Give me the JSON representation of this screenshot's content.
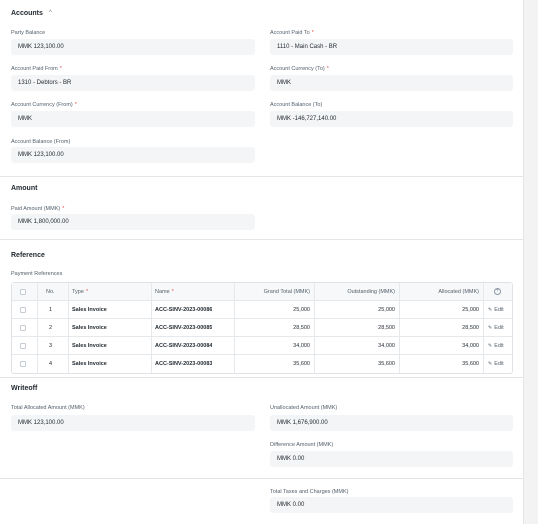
{
  "accounts": {
    "title": "Accounts",
    "party_balance": {
      "label": "Party Balance",
      "value": "MMK 123,100.00"
    },
    "account_paid_to": {
      "label": "Account Paid To",
      "value": "1110 - Main Cash - BR"
    },
    "account_paid_from": {
      "label": "Account Paid From",
      "value": "1310 - Debtors - BR"
    },
    "account_currency_to": {
      "label": "Account Currency (To)",
      "value": "MMK"
    },
    "account_currency_from": {
      "label": "Account Currency (From)",
      "value": "MMK"
    },
    "account_balance_to": {
      "label": "Account Balance (To)",
      "value": "MMK -146,727,140.00"
    },
    "account_balance_from": {
      "label": "Account Balance (From)",
      "value": "MMK 123,100.00"
    }
  },
  "amount": {
    "title": "Amount",
    "paid_amount": {
      "label": "Paid Amount (MMK)",
      "value": "MMK 1,800,000.00"
    }
  },
  "reference": {
    "title": "Reference",
    "table_label": "Payment References",
    "columns": [
      "No.",
      "Type",
      "Name",
      "Grand Total (MMK)",
      "Outstanding (MMK)",
      "Allocated (MMK)"
    ],
    "edit_label": "Edit",
    "rows": [
      {
        "no": "1",
        "type": "Sales Invoice",
        "name": "ACC-SINV-2023-00086",
        "grand_total": "25,000",
        "outstanding": "25,000",
        "allocated": "25,000"
      },
      {
        "no": "2",
        "type": "Sales Invoice",
        "name": "ACC-SINV-2023-00085",
        "grand_total": "28,500",
        "outstanding": "28,500",
        "allocated": "28,500"
      },
      {
        "no": "3",
        "type": "Sales Invoice",
        "name": "ACC-SINV-2023-00084",
        "grand_total": "34,000",
        "outstanding": "34,000",
        "allocated": "34,000"
      },
      {
        "no": "4",
        "type": "Sales Invoice",
        "name": "ACC-SINV-2023-00083",
        "grand_total": "35,600",
        "outstanding": "35,600",
        "allocated": "35,600"
      }
    ]
  },
  "writeoff": {
    "title": "Writeoff",
    "total_allocated": {
      "label": "Total Allocated Amount (MMK)",
      "value": "MMK 123,100.00"
    },
    "unallocated": {
      "label": "Unallocated Amount (MMK)",
      "value": "MMK 1,676,900.00"
    },
    "difference": {
      "label": "Difference Amount (MMK)",
      "value": "MMK 0.00"
    }
  },
  "taxes": {
    "total_taxes": {
      "label": "Total Taxes and Charges (MMK)",
      "value": "MMK 0.00"
    }
  }
}
